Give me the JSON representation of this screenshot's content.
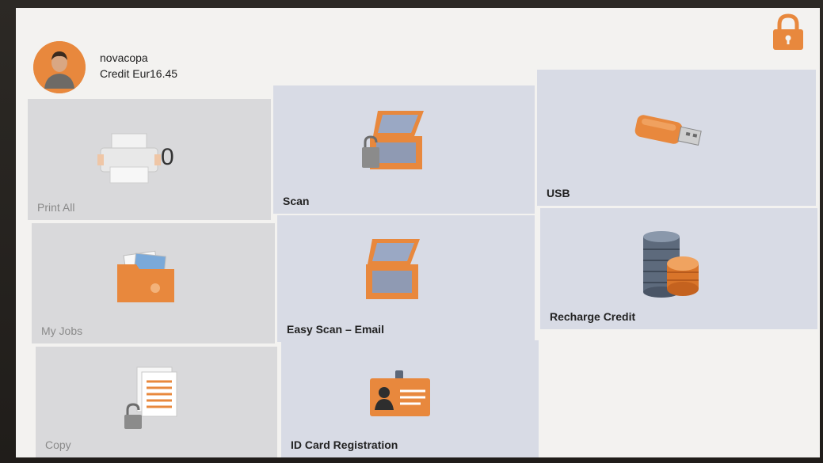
{
  "user": {
    "name": "novacopa",
    "credit": "Credit Eur16.45"
  },
  "lock": {
    "icon": "padlock-icon"
  },
  "tiles": [
    {
      "label": "Print All",
      "count": "0",
      "icon": "printer-icon",
      "enabled": false
    },
    {
      "label": "Scan",
      "icon": "scanner-locked-icon",
      "enabled": true
    },
    {
      "label": "USB",
      "icon": "usb-drive-icon",
      "enabled": true
    },
    {
      "label": "My Jobs",
      "icon": "folder-icon",
      "enabled": false
    },
    {
      "label": "Easy Scan – Email",
      "icon": "scanner-icon",
      "enabled": true
    },
    {
      "label": "Recharge Credit",
      "icon": "coins-icon",
      "enabled": true
    },
    {
      "label": "Copy",
      "icon": "document-locked-icon",
      "enabled": false
    },
    {
      "label": "ID Card Registration",
      "icon": "id-card-icon",
      "enabled": true
    }
  ],
  "colors": {
    "accent": "#e8883d",
    "tile": "#d8dbe5",
    "disabled_tile": "#d9d9db"
  }
}
